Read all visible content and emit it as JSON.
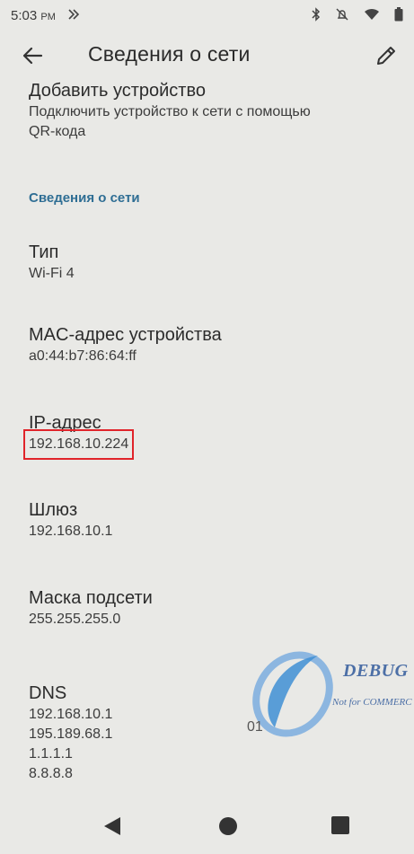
{
  "status_bar": {
    "time": "5:03",
    "ampm": "PM"
  },
  "app_bar": {
    "title": "Сведения о сети"
  },
  "items": {
    "add_device": {
      "title": "Добавить устройство",
      "summary_line1": "Подключить устройство к сети с помощью",
      "summary_line2": "QR-кода"
    },
    "section_header": "Сведения о сети",
    "type": {
      "title": "Тип",
      "value": "Wi-Fi 4"
    },
    "mac": {
      "title": "MAC-адрес устройства",
      "value": "a0:44:b7:86:64:ff"
    },
    "ip": {
      "title": "IP-адрес",
      "value": "192.168.10.224"
    },
    "gateway": {
      "title": "Шлюз",
      "value": "192.168.10.1"
    },
    "subnet": {
      "title": "Маска подсети",
      "value": "255.255.255.0"
    },
    "dns": {
      "title": "DNS",
      "values": [
        "192.168.10.1",
        "195.189.68.1",
        "1.1.1.1",
        "8.8.8.8"
      ]
    }
  },
  "watermark": {
    "text": "DEBUG",
    "sub": "Not for COMMERC",
    "code": "01"
  },
  "colors": {
    "accent": "#2f6e94",
    "highlight": "#e0242a",
    "background": "#e9e9e6"
  }
}
